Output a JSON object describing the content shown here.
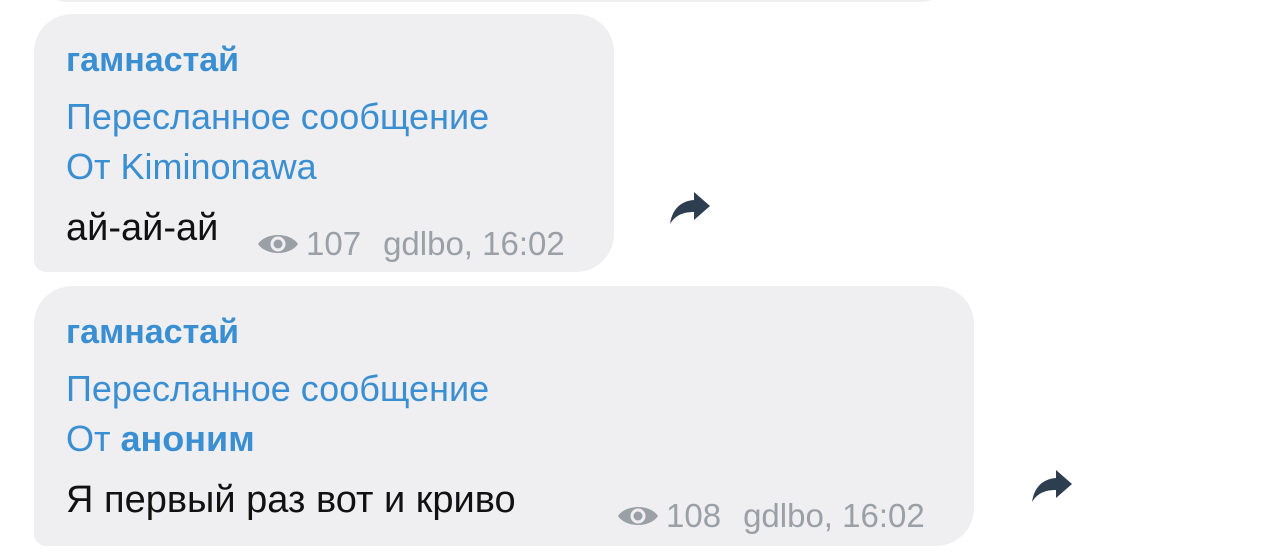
{
  "messages": [
    {
      "sender": "гамнастай",
      "forwarded_label": "Пересланное сообщение",
      "forwarded_from_prefix": "От",
      "forwarded_from": "Kiminonawa",
      "text": "ай-ай-ай",
      "views": "107",
      "signature_time": "gdlbo, 16:02"
    },
    {
      "sender": "гамнастай",
      "forwarded_label": "Пересланное сообщение",
      "forwarded_from_prefix": "От",
      "forwarded_from": "аноним",
      "text": "Я первый раз вот и криво",
      "views": "108",
      "signature_time": "gdlbo, 16:02"
    }
  ],
  "colors": {
    "bubble_bg": "#efeff1",
    "accent_blue": "#3a8fd2",
    "meta_grey": "#9aa0a6",
    "share_icon": "#2c3e50"
  },
  "icons": {
    "views": "eye-icon",
    "share": "share-arrow-icon"
  }
}
